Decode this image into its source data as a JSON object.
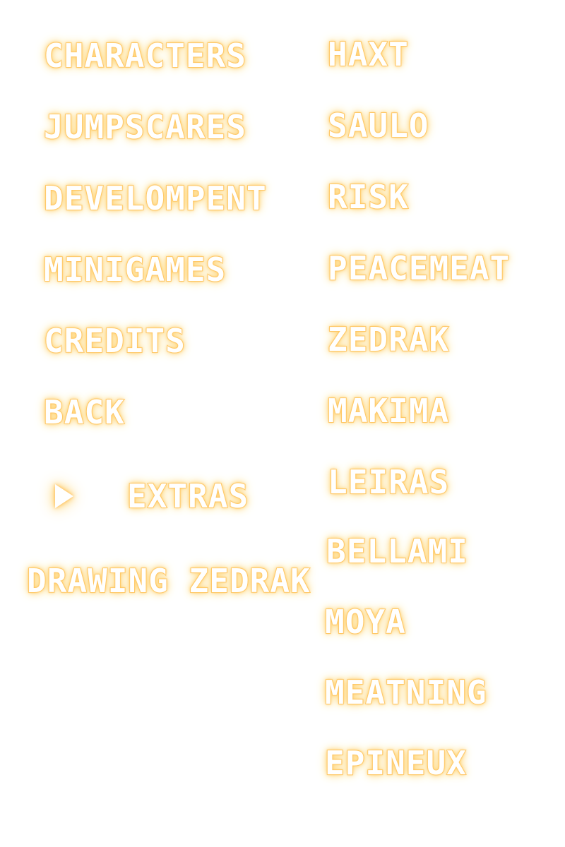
{
  "menu": {
    "left_items": [
      {
        "label": "CHARACTERS"
      },
      {
        "label": "JUMPSCARES"
      },
      {
        "label": "DEVELOMPENT"
      },
      {
        "label": "MINIGAMES"
      },
      {
        "label": "CREDITS"
      },
      {
        "label": "BACK"
      }
    ],
    "selected_label": "EXTRAS",
    "subtitle": "DRAWING ZEDRAK",
    "cursor_icon": "triangle-right-icon"
  },
  "characters": {
    "items": [
      {
        "label": "HAXT"
      },
      {
        "label": "SAULO"
      },
      {
        "label": "RISK"
      },
      {
        "label": "PEACEMEAT"
      },
      {
        "label": "ZEDRAK"
      },
      {
        "label": "MAKIMA"
      },
      {
        "label": "LEIRAS"
      },
      {
        "label": "BELLAMI"
      },
      {
        "label": "MOYA"
      },
      {
        "label": "MEATNING"
      },
      {
        "label": "EPINEUX"
      }
    ]
  },
  "colors": {
    "text": "#ffffff",
    "glow": "#ffc566"
  }
}
